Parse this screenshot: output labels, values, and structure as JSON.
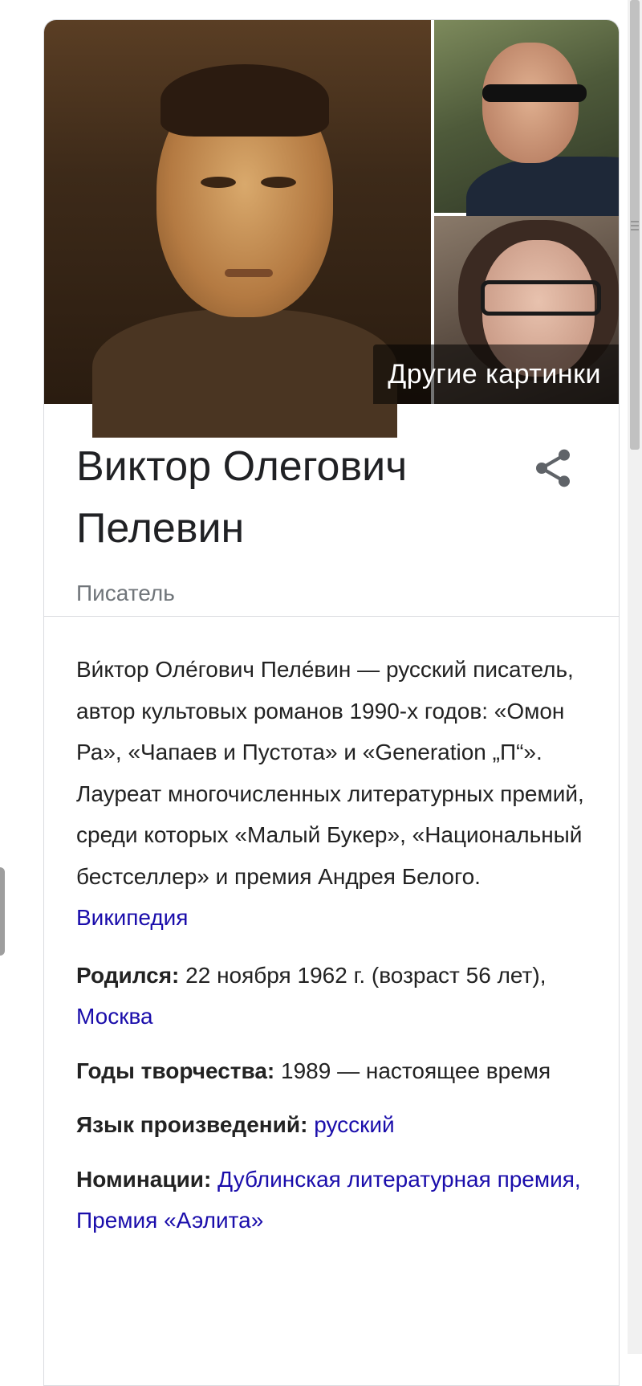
{
  "images": {
    "more_label": "Другие картинки"
  },
  "header": {
    "title": "Виктор Олегович Пелевин",
    "subtitle": "Писатель"
  },
  "description": {
    "text": "Ви́ктор Оле́гович Пеле́вин — русский писатель, автор культовых романов 1990-х годов: «Омон Ра», «Чапаев и Пустота» и «Generation „П“». Лауреат многочисленных литературных премий, среди которых «Малый Букер», «Национальный бестселлер» и премия Андрея Белого.",
    "source_link": "Википедия"
  },
  "facts": [
    {
      "key": "Родился:",
      "value": "22 ноября 1962 г. (возраст 56 лет),",
      "link": "Москва"
    },
    {
      "key": "Годы творчества:",
      "value": "1989 — настоящее время",
      "link": ""
    },
    {
      "key": "Язык произведений:",
      "value": "",
      "link": "русский"
    },
    {
      "key": "Номинации:",
      "value": "",
      "link": "Дублинская литературная премия, Премия «Аэлита»"
    }
  ],
  "colors": {
    "link": "#1a0dab",
    "subtitle": "#70757a",
    "border": "#dadce0"
  },
  "icons": {
    "share": "share-icon"
  }
}
